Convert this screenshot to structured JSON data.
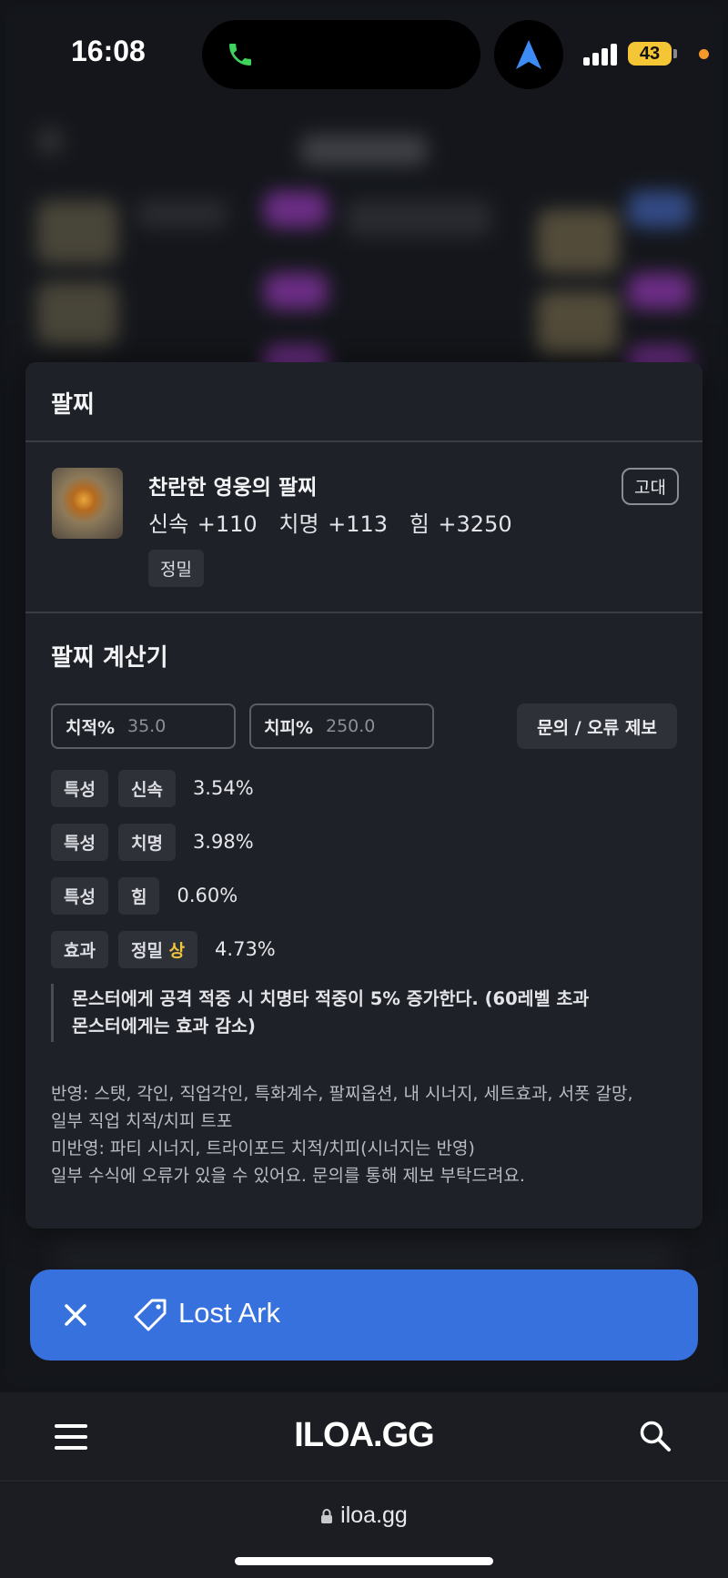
{
  "status_bar": {
    "time": "16:08",
    "battery": "43"
  },
  "modal": {
    "header_title": "팔찌",
    "item": {
      "name": "찬란한 영웅의 팔찌",
      "stats": [
        "신속 +110",
        "치명 +113",
        "힘 +3250"
      ],
      "grade": "고대",
      "tag": "정밀"
    },
    "calculator": {
      "title": "팔찌 계산기",
      "crit_rate_label": "치적%",
      "crit_rate_placeholder": "35.0",
      "crit_dmg_label": "치피%",
      "crit_dmg_placeholder": "250.0",
      "report_button": "문의 / 오류 제보",
      "rows": [
        {
          "type": "특성",
          "name": "신속",
          "suffix": "",
          "pct": "3.54%"
        },
        {
          "type": "특성",
          "name": "치명",
          "suffix": "",
          "pct": "3.98%"
        },
        {
          "type": "특성",
          "name": "힘",
          "suffix": "",
          "pct": "0.60%"
        },
        {
          "type": "효과",
          "name": "정밀",
          "suffix": "상",
          "pct": "4.73%"
        }
      ],
      "effect_desc_line1": "몬스터에게 공격 적중 시 치명타 적중이 5% 증가한다. (60레벨 초과",
      "effect_desc_line2": "몬스터에게는 효과 감소)",
      "notes": [
        "반영: 스탯, 각인, 직업각인, 특화계수, 팔찌옵션, 내 시너지, 세트효과, 서폿 갈망,",
        "일부 직업 치적/치피 트포",
        "미반영: 파티 시너지, 트라이포드 치적/치피(시너지는 반영)",
        "일부 수식에 오류가 있을 수 있어요. 문의를 통해 제보 부탁드려요."
      ]
    }
  },
  "chip": {
    "label": "Lost Ark"
  },
  "site_nav": {
    "logo": "ILOA.GG"
  },
  "url_bar": {
    "url": "iloa.gg"
  },
  "colors": {
    "chip_bg": "#3771de",
    "card_bg": "#1f2128",
    "highlight": "#f0c53a"
  }
}
